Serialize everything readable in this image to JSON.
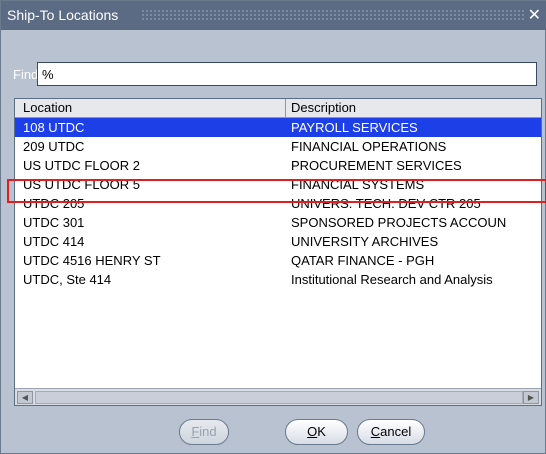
{
  "window": {
    "title": "Ship-To Locations",
    "close_glyph": "✕"
  },
  "find": {
    "label": "Find",
    "value": "%"
  },
  "list": {
    "columns": [
      "Location",
      "Description"
    ],
    "rows": [
      {
        "location": "108 UTDC",
        "description": "PAYROLL SERVICES",
        "selected": true
      },
      {
        "location": "209 UTDC",
        "description": "FINANCIAL OPERATIONS"
      },
      {
        "location": "US UTDC FLOOR 2",
        "description": "PROCUREMENT SERVICES"
      },
      {
        "location": "US UTDC FLOOR 5",
        "description": "FINANCIAL SYSTEMS",
        "highlighted": true
      },
      {
        "location": "UTDC 205",
        "description": "UNIVERS. TECH. DEV CTR 205"
      },
      {
        "location": "UTDC 301",
        "description": "SPONSORED PROJECTS ACCOUN"
      },
      {
        "location": "UTDC 414",
        "description": "UNIVERSITY ARCHIVES"
      },
      {
        "location": "UTDC 4516 HENRY ST",
        "description": "QATAR FINANCE - PGH"
      },
      {
        "location": "UTDC, Ste 414",
        "description": "Institutional Research and Analysis"
      }
    ]
  },
  "buttons": {
    "find": {
      "mnemonic": "F",
      "rest": "ind",
      "enabled": false
    },
    "ok": {
      "mnemonic": "O",
      "rest": "K"
    },
    "cancel": {
      "mnemonic": "C",
      "rest": "ancel"
    }
  },
  "colors": {
    "selection": "#1c3fe8",
    "highlight_box": "#e02020",
    "titlebar": "#5b6b84",
    "dialog_bg": "#b8c2d0"
  },
  "icons": {
    "close": "close-icon",
    "scroll_left": "scroll-left-icon",
    "scroll_right": "scroll-right-icon"
  }
}
